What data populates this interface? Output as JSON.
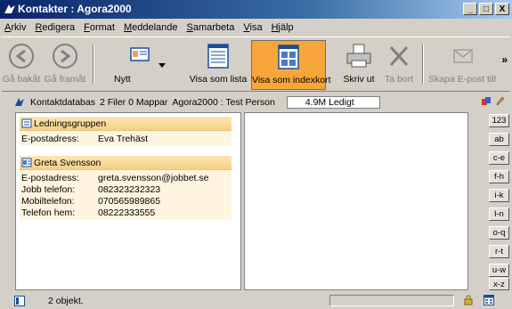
{
  "window": {
    "title": "Kontakter : Agora2000",
    "controls": [
      "_",
      "□",
      "X"
    ]
  },
  "menu": [
    {
      "pre": "",
      "u": "A",
      "post": "rkiv"
    },
    {
      "pre": "",
      "u": "R",
      "post": "edigera"
    },
    {
      "pre": "",
      "u": "F",
      "post": "ormat"
    },
    {
      "pre": "",
      "u": "M",
      "post": "eddelande"
    },
    {
      "pre": "",
      "u": "S",
      "post": "amarbeta"
    },
    {
      "pre": "",
      "u": "V",
      "post": "isa"
    },
    {
      "pre": "",
      "u": "H",
      "post": "jälp"
    }
  ],
  "toolbar": {
    "back": "Gå bakåt",
    "forward": "Gå framåt",
    "new": "Nytt",
    "view_list": "Visa som lista",
    "view_index": "Visa som indexkort",
    "print": "Skriv ut",
    "delete": "Ta bort",
    "create_email": "Skapa E-post till",
    "more": "»"
  },
  "pathbar": {
    "db": "Kontaktdatabas",
    "counts": "2 Filer 0 Mappar",
    "path": "Agora2000 : Test Person",
    "free": "4.9M Ledigt"
  },
  "cards": [
    {
      "name": "Ledningsgruppen",
      "fields": [
        {
          "label": "E-postadress:",
          "value": "Eva Trehäst"
        }
      ]
    },
    {
      "name": "Greta Svensson",
      "fields": [
        {
          "label": "E-postadress:",
          "value": "greta.svensson@jobbet.se"
        },
        {
          "label": "Jobb telefon:",
          "value": "082323232323"
        },
        {
          "label": "Mobiltelefon:",
          "value": "070565989865"
        },
        {
          "label": "Telefon hem:",
          "value": "08222333555"
        }
      ]
    }
  ],
  "index_tabs": [
    "123",
    "ab",
    "c-e",
    "f-h",
    "i-k",
    "l-n",
    "o-q",
    "r-t",
    "u-w",
    "x-z"
  ],
  "status": {
    "text": "2 objekt."
  },
  "colors": {
    "title_start": "#0a246a",
    "title_end": "#a6caf0",
    "active_tool": "#f7a63a",
    "card_header": "#f6cf83",
    "card_body": "#fff4df"
  }
}
